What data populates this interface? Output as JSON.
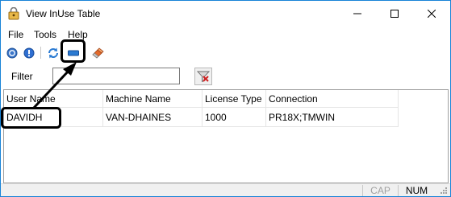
{
  "window": {
    "title": "View InUse Table"
  },
  "menu": {
    "items": [
      "File",
      "Tools",
      "Help"
    ]
  },
  "toolbar": {
    "buttons": [
      "help-icon",
      "info-icon",
      "refresh-icon",
      "remove-icon",
      "eraser-icon"
    ]
  },
  "filter": {
    "label": "Filter",
    "value": "",
    "placeholder": ""
  },
  "table": {
    "columns": [
      "User Name",
      "Machine Name",
      "License Type",
      "Connection"
    ],
    "rows": [
      [
        "DAVIDH",
        "VAN-DHAINES",
        "1000",
        "PR18X;TMWIN"
      ]
    ]
  },
  "status": {
    "cap": "CAP",
    "num": "NUM"
  },
  "colors": {
    "accent": "#1883d7",
    "annotation": "#000000",
    "remove_button": "#2a7ad2"
  }
}
